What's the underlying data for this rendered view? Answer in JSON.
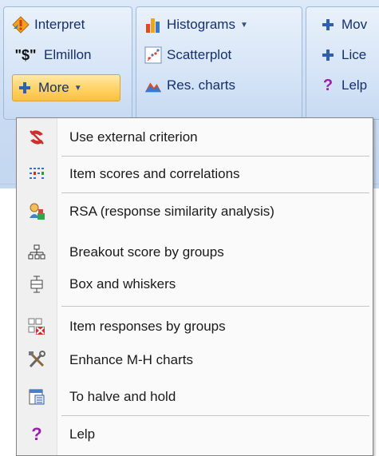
{
  "ribbon": {
    "group1": [
      {
        "label": "Interpret",
        "icon": "warning-diamond-icon"
      },
      {
        "label": "Elmillon",
        "icon": "dollar-sign-icon",
        "icon_text": "\"$\""
      },
      {
        "label": "More",
        "icon": "plus-icon",
        "has_dropdown": true
      }
    ],
    "group2": [
      {
        "label": "Histograms",
        "icon": "histogram-icon",
        "has_dropdown": true
      },
      {
        "label": "Scatterplot",
        "icon": "scatterplot-icon"
      },
      {
        "label": "Res. charts",
        "icon": "mountain-chart-icon"
      }
    ],
    "group3": [
      {
        "label": "Mov",
        "icon": "plus-icon"
      },
      {
        "label": "Lice",
        "icon": "plus-icon"
      },
      {
        "label": "Lelp",
        "icon": "help-icon"
      }
    ]
  },
  "menu": {
    "items": [
      {
        "label": "Use external criterion",
        "icon": "external-criterion-icon"
      },
      {
        "label": "Item scores and correlations",
        "icon": "item-scores-icon"
      },
      {
        "label": "RSA (response similarity analysis)",
        "icon": "rsa-icon"
      },
      {
        "label": "Breakout score by groups",
        "icon": "hierarchy-icon"
      },
      {
        "label": "Box and whiskers",
        "icon": "box-whiskers-icon"
      },
      {
        "label": "Item responses by groups",
        "icon": "item-responses-icon"
      },
      {
        "label": "Enhance M-H charts",
        "icon": "tools-icon"
      },
      {
        "label": "To halve and hold",
        "icon": "halve-icon"
      },
      {
        "label": "Lelp",
        "icon": "help-icon"
      }
    ]
  },
  "colors": {
    "ribbon_bg": "#c9dbf2",
    "highlight": "#ffd46b",
    "menu_bg": "#fafafa",
    "text": "#15306b"
  }
}
